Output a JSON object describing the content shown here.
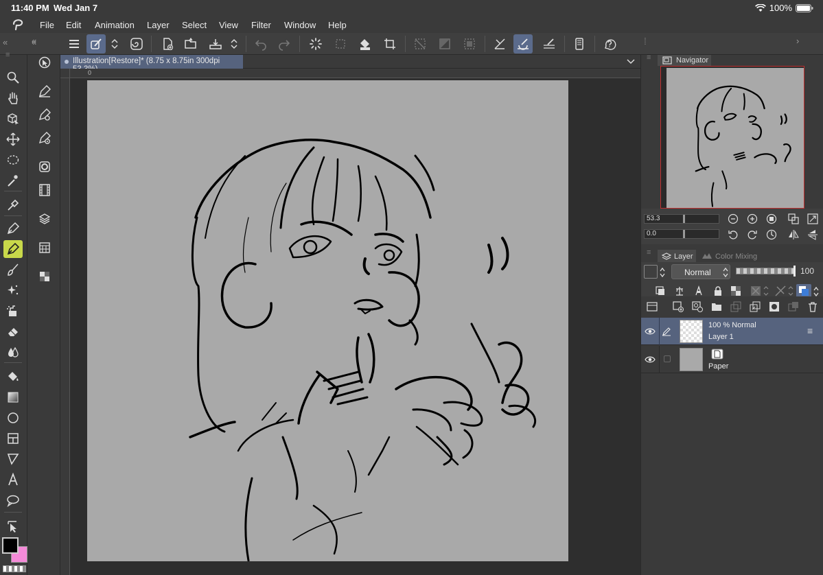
{
  "status_bar": {
    "time": "11:40 PM",
    "date": "Wed Jan 7",
    "battery": "100%"
  },
  "menu": [
    "File",
    "Edit",
    "Animation",
    "Layer",
    "Select",
    "View",
    "Filter",
    "Window",
    "Help"
  ],
  "document_tab": {
    "title": "Illustration[Restore]* (8.75 x 8.75in 300dpi 53.3%)"
  },
  "ruler": {
    "origin_label": "0"
  },
  "navigator": {
    "tab_label": "Navigator",
    "zoom_value": "53.3",
    "rotation_value": "0.0"
  },
  "layer_panel": {
    "tab_layer": "Layer",
    "tab_color_mixing": "Color Mixing",
    "blend_mode": "Normal",
    "opacity": "100",
    "layers": [
      {
        "name": "Layer 1",
        "info": "100 %  Normal",
        "selected": true,
        "visible": true
      },
      {
        "name": "Paper",
        "info": "",
        "selected": false,
        "visible": true
      }
    ]
  },
  "colors": {
    "accent": "#56637e",
    "active_tool": "#c8d84a",
    "main_color": "#000000",
    "sub_color": "#f48ad8",
    "paper": "#a9a9a9"
  }
}
